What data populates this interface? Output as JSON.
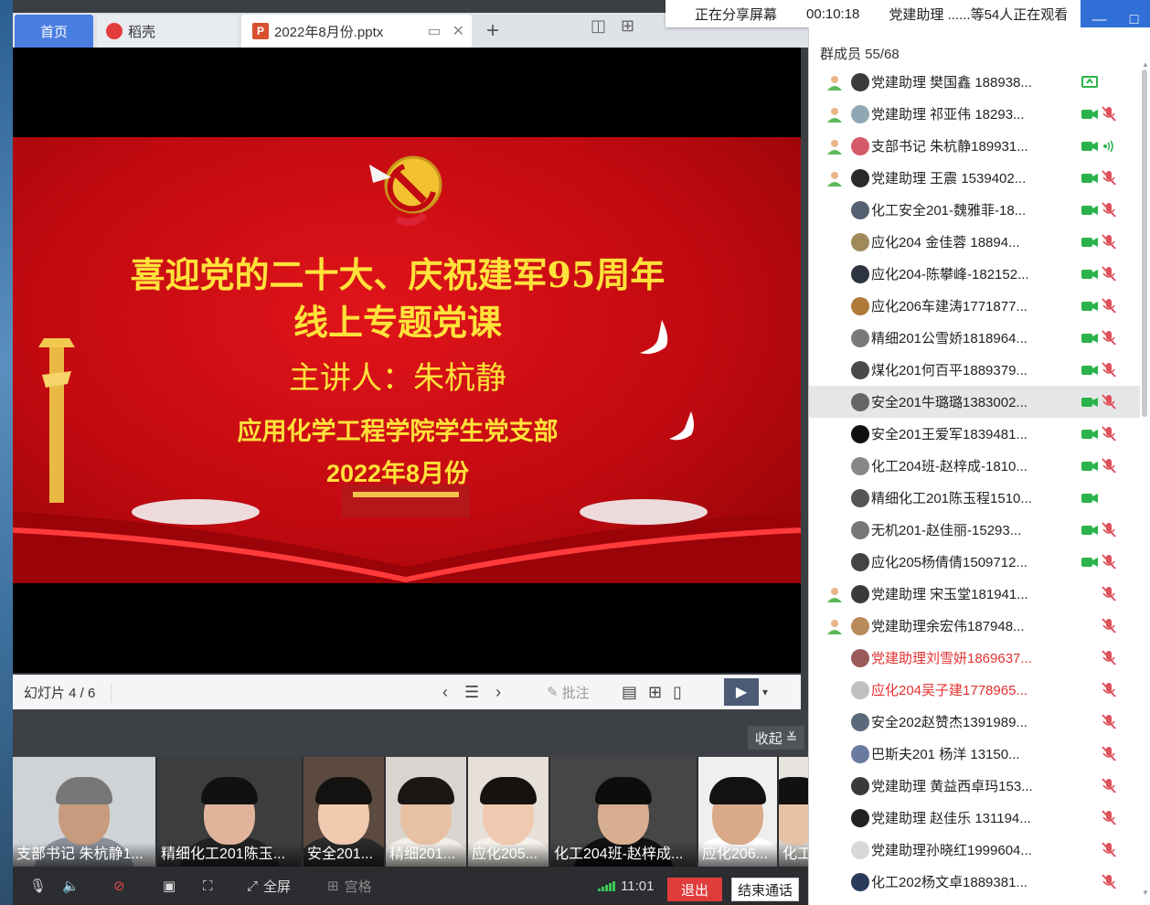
{
  "tabs": {
    "home": "首页",
    "daoke": "稻壳",
    "file": "2022年8月份.pptx"
  },
  "share_banner": {
    "status": "正在分享屏幕",
    "timer": "00:10:18",
    "viewers": "党建助理 ......等54人正在观看"
  },
  "slide": {
    "title_line1": "喜迎党的二十大、庆祝建军95周年",
    "title_line2": "线上专题党课",
    "speaker": "主讲人：朱杭静",
    "college": "应用化学工程学院学生党支部",
    "date": "2022年8月份"
  },
  "slide_nav": {
    "counter": "幻灯片 4 / 6",
    "annotate": "批注"
  },
  "collapse_label": "收起",
  "videos": [
    {
      "label": "支部书记 朱杭静1...",
      "bg": "#cfd3d6",
      "shirt": "#8a8f9a",
      "skin": "#c79b7d",
      "hair": "#777"
    },
    {
      "label": "精细化工201陈玉...",
      "bg": "#3b3d3f",
      "shirt": "#222",
      "skin": "#e0b49a",
      "hair": "#111"
    },
    {
      "label": "安全201...",
      "bg": "#5c4a40",
      "shirt": "#2a2a2a",
      "skin": "#f0c9ae",
      "hair": "#141210"
    },
    {
      "label": "精细201...",
      "bg": "#d9d4cf",
      "shirt": "#f2efe9",
      "skin": "#e8c0a4",
      "hair": "#1a1715"
    },
    {
      "label": "应化205...",
      "bg": "#e6e0d8",
      "shirt": "#f5f2ec",
      "skin": "#f0cab0",
      "hair": "#151210"
    },
    {
      "label": "化工204班-赵梓成...",
      "bg": "#454645",
      "shirt": "#111",
      "skin": "#d8ae90",
      "hair": "#0e0d0c"
    },
    {
      "label": "应化206...",
      "bg": "#efefee",
      "shirt": "#fff",
      "skin": "#d9a98a",
      "hair": "#141211"
    },
    {
      "label": "化工",
      "bg": "#e7e4e0",
      "shirt": "#d6d3cf",
      "skin": "#e8c2a5",
      "hair": "#111"
    }
  ],
  "bottom_bar": {
    "fullscreen": "全屏",
    "grid": "宫格",
    "time": "11:01",
    "exit": "退出",
    "end_call": "结束通话"
  },
  "members": {
    "header": "群成员 55/68",
    "list": [
      {
        "name": "党建助理 樊国鑫 188938...",
        "host": true,
        "avatar": "#3b3b3b",
        "cam": "screen",
        "mic": "none",
        "red": false
      },
      {
        "name": "党建助理 祁亚伟 18293...",
        "host": true,
        "avatar": "#8fa8b4",
        "cam": "on",
        "mic": "muted",
        "red": false
      },
      {
        "name": "支部书记 朱杭静189931...",
        "host": true,
        "avatar": "#d35a66",
        "cam": "on",
        "mic": "speaking",
        "red": false
      },
      {
        "name": "党建助理  王震 1539402...",
        "host": true,
        "avatar": "#2a2a2a",
        "cam": "on",
        "mic": "muted",
        "red": false
      },
      {
        "name": "化工安全201-魏雅菲-18...",
        "host": false,
        "avatar": "#556070",
        "cam": "on",
        "mic": "muted",
        "red": false
      },
      {
        "name": "应化204  金佳蓉 18894...",
        "host": false,
        "avatar": "#a08a5a",
        "cam": "on",
        "mic": "muted",
        "red": false
      },
      {
        "name": "应化204-陈攀峰-182152...",
        "host": false,
        "avatar": "#2e3440",
        "cam": "on",
        "mic": "muted",
        "red": false
      },
      {
        "name": "应化206车建涛1771877...",
        "host": false,
        "avatar": "#b07a3a",
        "cam": "on",
        "mic": "muted",
        "red": false
      },
      {
        "name": "精细201公雪娇1818964...",
        "host": false,
        "avatar": "#7a7a7a",
        "cam": "on",
        "mic": "muted",
        "red": false
      },
      {
        "name": "煤化201何百平1889379...",
        "host": false,
        "avatar": "#4a4a4a",
        "cam": "on",
        "mic": "muted",
        "red": false
      },
      {
        "name": "安全201牛璐璐1383002...",
        "host": false,
        "avatar": "#666",
        "cam": "on",
        "mic": "muted",
        "red": false,
        "highlight": true
      },
      {
        "name": "安全201王爱军1839481...",
        "host": false,
        "avatar": "#111",
        "cam": "on",
        "mic": "muted",
        "red": false
      },
      {
        "name": "化工204班-赵梓成-1810...",
        "host": false,
        "avatar": "#888",
        "cam": "on",
        "mic": "muted",
        "red": false
      },
      {
        "name": "精细化工201陈玉程1510...",
        "host": false,
        "avatar": "#555",
        "cam": "on",
        "mic": "none",
        "red": false
      },
      {
        "name": "无机201-赵佳丽-15293...",
        "host": false,
        "avatar": "#777",
        "cam": "on",
        "mic": "muted",
        "red": false
      },
      {
        "name": "应化205杨倩倩1509712...",
        "host": false,
        "avatar": "#444",
        "cam": "on",
        "mic": "muted",
        "red": false
      },
      {
        "name": "党建助理 宋玉堂181941...",
        "host": true,
        "avatar": "#3a3a3a",
        "cam": "none",
        "mic": "muted",
        "red": false
      },
      {
        "name": "党建助理余宏伟187948...",
        "host": true,
        "avatar": "#b88a5a",
        "cam": "none",
        "mic": "muted",
        "red": false
      },
      {
        "name": "党建助理刘雪妍1869637...",
        "host": false,
        "avatar": "#9a5a5a",
        "cam": "none",
        "mic": "muted",
        "red": true
      },
      {
        "name": "应化204吴子建1778965...",
        "host": false,
        "avatar": "#c0c0c0",
        "cam": "none",
        "mic": "muted",
        "red": true
      },
      {
        "name": "安全202赵赞杰1391989...",
        "host": false,
        "avatar": "#5a6a7a",
        "cam": "none",
        "mic": "muted",
        "red": false
      },
      {
        "name": "巴斯夫201 杨洋  13150...",
        "host": false,
        "avatar": "#6a7aa0",
        "cam": "none",
        "mic": "muted",
        "red": false
      },
      {
        "name": "党建助理 黄益西卓玛153...",
        "host": false,
        "avatar": "#3a3a3a",
        "cam": "none",
        "mic": "muted",
        "red": false
      },
      {
        "name": "党建助理 赵佳乐 131194...",
        "host": false,
        "avatar": "#222",
        "cam": "none",
        "mic": "muted",
        "red": false
      },
      {
        "name": "党建助理孙晓红1999604...",
        "host": false,
        "avatar": "#d8d8d8",
        "cam": "none",
        "mic": "muted",
        "red": false
      },
      {
        "name": "化工202杨文卓1889381...",
        "host": false,
        "avatar": "#2a3a5a",
        "cam": "none",
        "mic": "muted",
        "red": false
      }
    ]
  },
  "colors": {
    "accent_blue": "#4a7de0",
    "slide_red": "#c10a10",
    "slide_text": "#ffe23a",
    "cam_green": "#2bb34a",
    "mic_muted_red": "#e0505a",
    "exit_red": "#e03c3c"
  }
}
